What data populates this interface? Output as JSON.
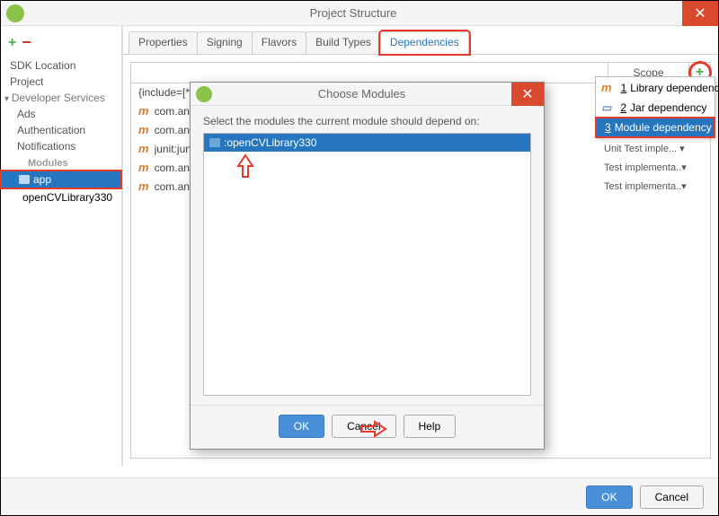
{
  "window": {
    "title": "Project Structure",
    "close_glyph": "✕"
  },
  "sidebar": {
    "items": [
      {
        "label": "SDK Location",
        "kind": "item"
      },
      {
        "label": "Project",
        "kind": "item"
      },
      {
        "label": "Developer Services",
        "kind": "section"
      },
      {
        "label": "Ads",
        "kind": "item"
      },
      {
        "label": "Authentication",
        "kind": "item"
      },
      {
        "label": "Notifications",
        "kind": "item"
      }
    ],
    "modules_heading": "Modules",
    "modules": [
      {
        "label": "app",
        "selected": true
      },
      {
        "label": "openCVLibrary330",
        "selected": false
      }
    ]
  },
  "tabs": [
    {
      "label": "Properties",
      "active": false
    },
    {
      "label": "Signing",
      "active": false
    },
    {
      "label": "Flavors",
      "active": false
    },
    {
      "label": "Build Types",
      "active": false
    },
    {
      "label": "Dependencies",
      "active": true
    }
  ],
  "dep_header": {
    "scope": "Scope",
    "plus": "+"
  },
  "dep_rows": [
    {
      "icon": "",
      "label": "{include=[*.jar], dir=libs}",
      "scope": ""
    },
    {
      "icon": "m",
      "label": "com.andro",
      "scope": ""
    },
    {
      "icon": "m",
      "label": "com.andro",
      "scope": ""
    },
    {
      "icon": "m",
      "label": "junit:junit:",
      "scope": "Unit Test imple... ▾"
    },
    {
      "icon": "m",
      "label": "com.andro",
      "scope": "Test implementa..▾"
    },
    {
      "icon": "m",
      "label": "com.andro",
      "scope": "Test implementa..▾"
    }
  ],
  "popup": {
    "items": [
      {
        "num": "1",
        "label": "Library dependency",
        "icon": "m"
      },
      {
        "num": "2",
        "label": "Jar dependency",
        "icon": "j"
      },
      {
        "num": "3",
        "label": "Module dependency",
        "icon": "f",
        "selected": true
      }
    ]
  },
  "modal": {
    "title": "Choose Modules",
    "close_glyph": "✕",
    "prompt": "Select the modules the current module should depend on:",
    "items": [
      {
        "label": ":openCVLibrary330",
        "selected": true
      }
    ],
    "buttons": {
      "ok": "OK",
      "cancel": "Cancel",
      "help": "Help"
    }
  },
  "footer": {
    "ok": "OK",
    "cancel": "Cancel"
  }
}
